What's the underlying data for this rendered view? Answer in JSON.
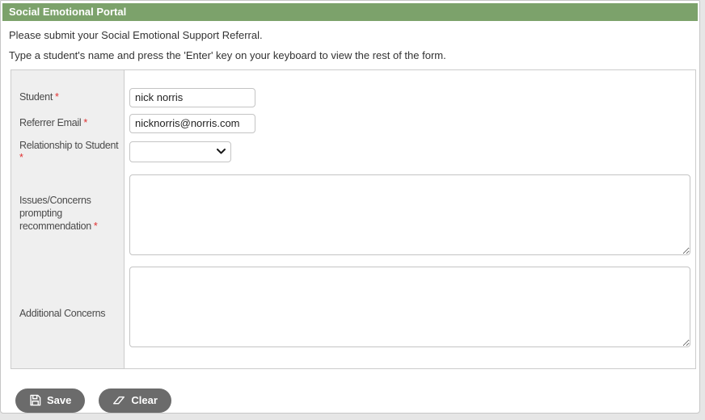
{
  "header": {
    "title": "Social Emotional Portal"
  },
  "instructions": {
    "line1": "Please submit your Social Emotional Support Referral.",
    "line2": "Type a student's name and press the 'Enter' key on your keyboard to view the rest of the form."
  },
  "form": {
    "required_marker": "*",
    "fields": {
      "student": {
        "label": "Student",
        "required": true,
        "value": "nick norris"
      },
      "referrer_email": {
        "label": "Referrer Email",
        "required": true,
        "value": "nicknorris@norris.com"
      },
      "relationship": {
        "label": "Relationship to Student",
        "required": true,
        "selected_value": ""
      },
      "issues": {
        "label": "Issues/Concerns prompting recommendation",
        "required": true,
        "value": ""
      },
      "additional": {
        "label": "Additional Concerns",
        "required": false,
        "value": ""
      }
    }
  },
  "buttons": {
    "save_label": "Save",
    "clear_label": "Clear"
  },
  "icons": {
    "save": "floppy-disk-icon",
    "clear": "eraser-icon",
    "dropdown": "chevron-down-icon"
  },
  "colors": {
    "header_bg": "#7CA26B",
    "header_text": "#ffffff",
    "label_column_bg": "#efefef",
    "table_border": "#cccccc",
    "button_bg": "#6b6b6b",
    "required_asterisk": "#e03030"
  }
}
